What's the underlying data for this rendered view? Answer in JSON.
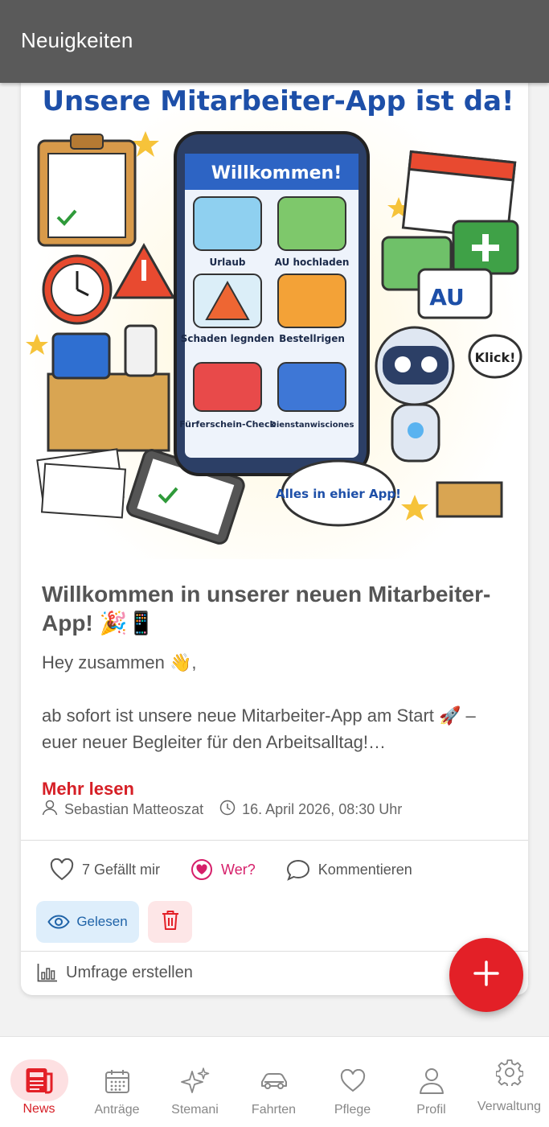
{
  "appbar": {
    "title": "Neuigkeiten"
  },
  "post": {
    "image": {
      "headline": "Unsere Mitarbeiter-App ist da!",
      "phone_header": "Willkommen!",
      "tiles": [
        "Urlaub",
        "AU hochladen",
        "Schaden legnden",
        "Bestellrigen",
        "Fürferschein-Check",
        "Dienstanwisciones"
      ],
      "badge_au": "AU",
      "bubble_klick": "Klick!",
      "bubble_alles": "Alles in ehier App!"
    },
    "title": "Willkommen in unserer neuen Mitarbeiter-App! 🎉📱",
    "greeting": "Hey zusammen 👋,",
    "body": "ab sofort ist unsere neue Mitarbeiter-App am Start 🚀 – euer neuer Begleiter für den Arbeitsalltag!…",
    "read_more": "Mehr lesen",
    "author": "Sebastian Matteoszat",
    "date": "16. April 2026, 08:30 Uhr",
    "likes_label": "7 Gefällt mir",
    "who_label": "Wer?",
    "comment_label": "Kommentieren",
    "read_label": "Gelesen",
    "poll_label": "Umfrage erstellen"
  },
  "nav": {
    "items": [
      {
        "label": "News",
        "icon": "newspaper-icon",
        "active": true
      },
      {
        "label": "Anträge",
        "icon": "calendar-icon",
        "active": false
      },
      {
        "label": "Stemani",
        "icon": "sparkles-icon",
        "active": false
      },
      {
        "label": "Fahrten",
        "icon": "car-icon",
        "active": false
      },
      {
        "label": "Pflege",
        "icon": "heart-icon",
        "active": false
      },
      {
        "label": "Profil",
        "icon": "person-icon",
        "active": false
      },
      {
        "label": "Verwaltung",
        "icon": "gear-icon",
        "active": false
      }
    ]
  },
  "colors": {
    "accent": "#e32027",
    "appbar": "#5a5a5a",
    "read_pill": "#deeefb",
    "delete_pill": "#fde6e7"
  }
}
